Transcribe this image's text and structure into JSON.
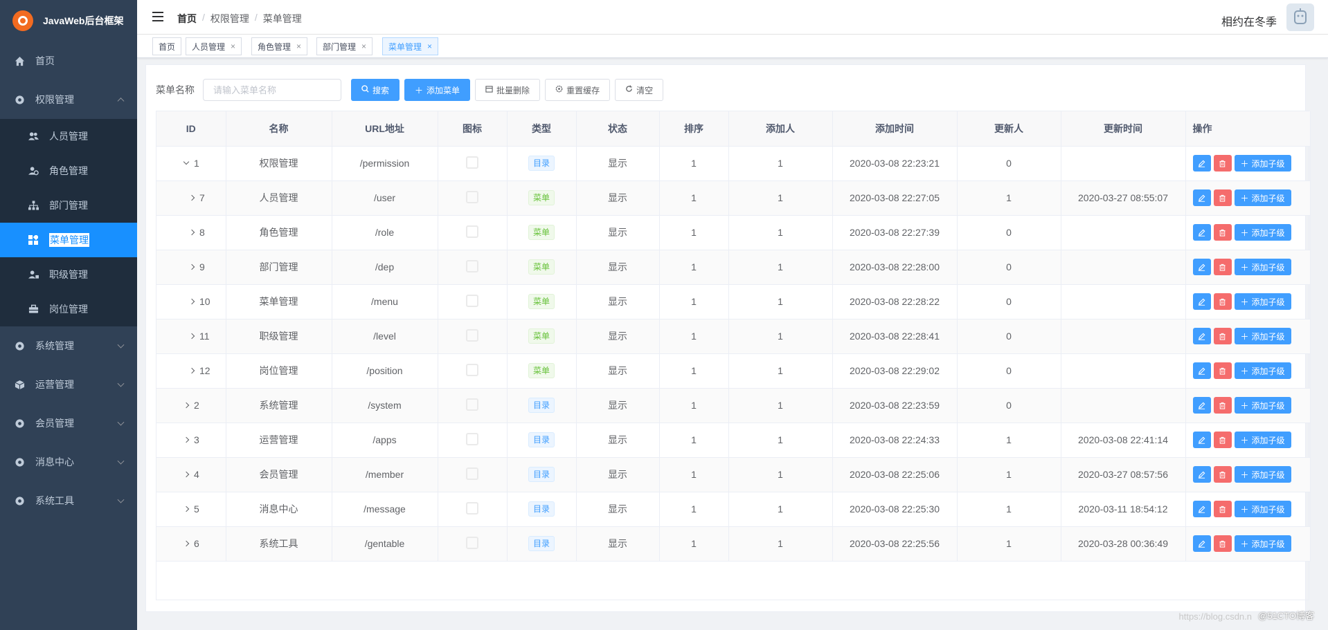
{
  "app": {
    "title": "JavaWeb后台框架"
  },
  "sidebar": {
    "items": [
      {
        "label": "首页",
        "icon": "home-icon"
      },
      {
        "label": "权限管理",
        "icon": "gear-icon",
        "expanded": true,
        "children": [
          {
            "label": "人员管理",
            "icon": "users-icon"
          },
          {
            "label": "角色管理",
            "icon": "role-icon"
          },
          {
            "label": "部门管理",
            "icon": "org-tree-icon"
          },
          {
            "label": "菜单管理",
            "icon": "grid-icon",
            "active": true
          },
          {
            "label": "职级管理",
            "icon": "user-level-icon"
          },
          {
            "label": "岗位管理",
            "icon": "briefcase-icon"
          }
        ]
      },
      {
        "label": "系统管理",
        "icon": "gear-icon"
      },
      {
        "label": "运营管理",
        "icon": "cube-icon"
      },
      {
        "label": "会员管理",
        "icon": "gear-icon"
      },
      {
        "label": "消息中心",
        "icon": "gear-icon"
      },
      {
        "label": "系统工具",
        "icon": "gear-icon"
      }
    ]
  },
  "header": {
    "breadcrumb": [
      "首页",
      "权限管理",
      "菜单管理"
    ],
    "user_name": "相约在冬季"
  },
  "tags": [
    {
      "label": "首页",
      "closable": false
    },
    {
      "label": "人员管理",
      "closable": true
    },
    {
      "label": "角色管理",
      "closable": true
    },
    {
      "label": "部门管理",
      "closable": true
    },
    {
      "label": "菜单管理",
      "closable": true,
      "active": true
    }
  ],
  "search": {
    "label": "菜单名称",
    "placeholder": "请输入菜单名称",
    "buttons": {
      "search": "搜索",
      "add": "添加菜单",
      "batch_delete": "批量删除",
      "reset_cache": "重置缓存",
      "clear": "清空"
    }
  },
  "table": {
    "columns": [
      "ID",
      "名称",
      "URL地址",
      "图标",
      "类型",
      "状态",
      "排序",
      "添加人",
      "添加时间",
      "更新人",
      "更新时间",
      "操作"
    ],
    "add_child_label": "添加子级",
    "rows": [
      {
        "id": "1",
        "name": "权限管理",
        "url": "/permission",
        "type": "目录",
        "type_kind": "dir",
        "status": "显示",
        "sort": "1",
        "creator": "1",
        "created": "2020-03-08 22:23:21",
        "updater": "0",
        "updated": "",
        "indent": 0,
        "expanded": true
      },
      {
        "id": "7",
        "name": "人员管理",
        "url": "/user",
        "type": "菜单",
        "type_kind": "menu",
        "status": "显示",
        "sort": "1",
        "creator": "1",
        "created": "2020-03-08 22:27:05",
        "updater": "1",
        "updated": "2020-03-27 08:55:07",
        "indent": 1
      },
      {
        "id": "8",
        "name": "角色管理",
        "url": "/role",
        "type": "菜单",
        "type_kind": "menu",
        "status": "显示",
        "sort": "1",
        "creator": "1",
        "created": "2020-03-08 22:27:39",
        "updater": "0",
        "updated": "",
        "indent": 1
      },
      {
        "id": "9",
        "name": "部门管理",
        "url": "/dep",
        "type": "菜单",
        "type_kind": "menu",
        "status": "显示",
        "sort": "1",
        "creator": "1",
        "created": "2020-03-08 22:28:00",
        "updater": "0",
        "updated": "",
        "indent": 1
      },
      {
        "id": "10",
        "name": "菜单管理",
        "url": "/menu",
        "type": "菜单",
        "type_kind": "menu",
        "status": "显示",
        "sort": "1",
        "creator": "1",
        "created": "2020-03-08 22:28:22",
        "updater": "0",
        "updated": "",
        "indent": 1
      },
      {
        "id": "11",
        "name": "职级管理",
        "url": "/level",
        "type": "菜单",
        "type_kind": "menu",
        "status": "显示",
        "sort": "1",
        "creator": "1",
        "created": "2020-03-08 22:28:41",
        "updater": "0",
        "updated": "",
        "indent": 1
      },
      {
        "id": "12",
        "name": "岗位管理",
        "url": "/position",
        "type": "菜单",
        "type_kind": "menu",
        "status": "显示",
        "sort": "1",
        "creator": "1",
        "created": "2020-03-08 22:29:02",
        "updater": "0",
        "updated": "",
        "indent": 1
      },
      {
        "id": "2",
        "name": "系统管理",
        "url": "/system",
        "type": "目录",
        "type_kind": "dir",
        "status": "显示",
        "sort": "1",
        "creator": "1",
        "created": "2020-03-08 22:23:59",
        "updater": "0",
        "updated": "",
        "indent": 0
      },
      {
        "id": "3",
        "name": "运营管理",
        "url": "/apps",
        "type": "目录",
        "type_kind": "dir",
        "status": "显示",
        "sort": "1",
        "creator": "1",
        "created": "2020-03-08 22:24:33",
        "updater": "1",
        "updated": "2020-03-08 22:41:14",
        "indent": 0
      },
      {
        "id": "4",
        "name": "会员管理",
        "url": "/member",
        "type": "目录",
        "type_kind": "dir",
        "status": "显示",
        "sort": "1",
        "creator": "1",
        "created": "2020-03-08 22:25:06",
        "updater": "1",
        "updated": "2020-03-27 08:57:56",
        "indent": 0
      },
      {
        "id": "5",
        "name": "消息中心",
        "url": "/message",
        "type": "目录",
        "type_kind": "dir",
        "status": "显示",
        "sort": "1",
        "creator": "1",
        "created": "2020-03-08 22:25:30",
        "updater": "1",
        "updated": "2020-03-11 18:54:12",
        "indent": 0
      },
      {
        "id": "6",
        "name": "系统工具",
        "url": "/gentable",
        "type": "目录",
        "type_kind": "dir",
        "status": "显示",
        "sort": "1",
        "creator": "1",
        "created": "2020-03-08 22:25:56",
        "updater": "1",
        "updated": "2020-03-28 00:36:49",
        "indent": 0
      }
    ]
  },
  "watermark": {
    "faint": "https://blog.csdn.n",
    "text": "@51CTO博客"
  },
  "colors": {
    "sidebar_bg": "#304156",
    "active": "#1890ff",
    "primary": "#409eff",
    "danger": "#f56c6c"
  }
}
